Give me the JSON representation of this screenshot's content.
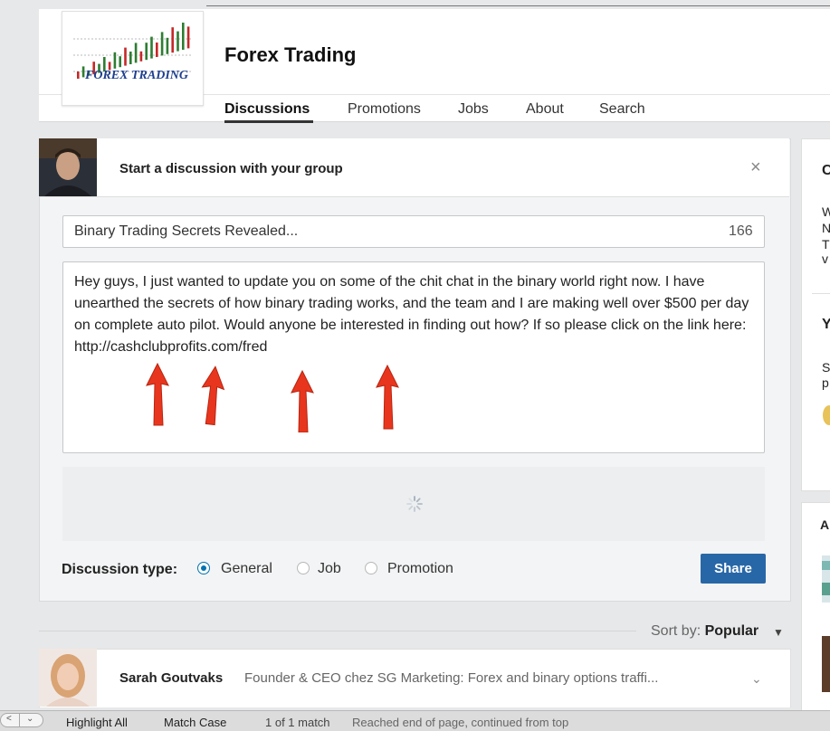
{
  "group": {
    "logo_text": "FOREX TRADING",
    "name": "Forex Trading",
    "tabs": [
      "Discussions",
      "Promotions",
      "Jobs",
      "About",
      "Search"
    ]
  },
  "composer": {
    "prompt": "Start a discussion with your group",
    "close": "×",
    "title_value": "Binary Trading Secrets Revealed...",
    "title_char_count": "166",
    "body_value": "Hey guys, I just wanted to update you on some of the chit chat in the binary world right now.  I have unearthed the secrets of how binary trading works, and the team and I are making well over $500 per day on complete auto pilot.  Would anyone be interested in finding out how?  If so please click on the link here: http://cashclubprofits.com/fred",
    "type_label": "Discussion type:",
    "types": [
      {
        "label": "General",
        "checked": true
      },
      {
        "label": "Job",
        "checked": false
      },
      {
        "label": "Promotion",
        "checked": false
      }
    ],
    "share_label": "Share"
  },
  "sort": {
    "label": "Sort by:",
    "value": "Popular"
  },
  "post": {
    "author": "Sarah Goutvaks",
    "headline": "Founder & CEO chez SG Marketing: Forex and binary options traffi..."
  },
  "sidebar": {
    "fragments": [
      "C",
      "W",
      "N",
      "T",
      "v",
      "Y",
      "S",
      "p",
      "A"
    ]
  },
  "find_bar": {
    "highlight_all": "Highlight All",
    "match_case": "Match Case",
    "match_count": "1 of 1 match",
    "status": "Reached end of page, continued from top"
  },
  "colors": {
    "accent": "#2867a7",
    "radio_selected": "#0073b1",
    "annotation_arrow": "#e8361e"
  }
}
